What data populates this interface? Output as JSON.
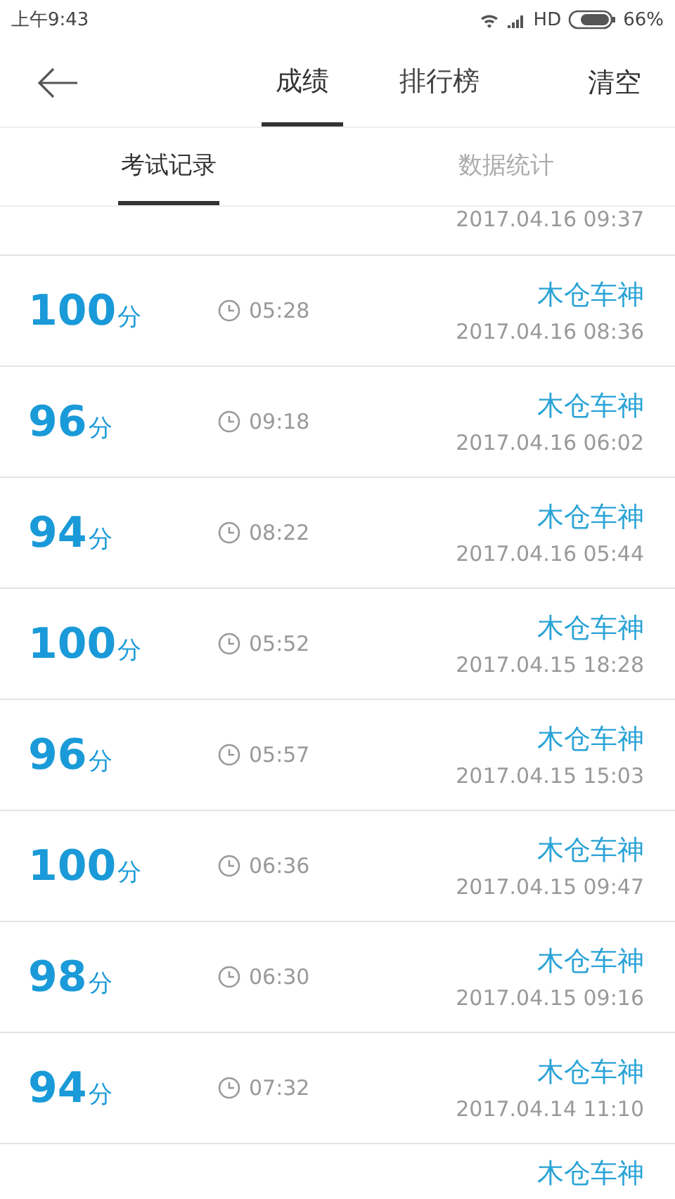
{
  "status_bar": {
    "time": "上午9:43",
    "network": "HD",
    "battery": "66%"
  },
  "header": {
    "tabs": [
      {
        "label": "成绩",
        "selected": true
      },
      {
        "label": "排行榜",
        "selected": false
      }
    ],
    "action": "清空"
  },
  "subtabs": [
    {
      "label": "考试记录",
      "selected": true
    },
    {
      "label": "数据统计",
      "selected": false
    }
  ],
  "records": [
    {
      "date": "2017.04.16  09:37"
    },
    {
      "score": "100",
      "unit": "分",
      "duration": "05:28",
      "name": "木仓车神",
      "date": "2017.04.16  08:36"
    },
    {
      "score": "96",
      "unit": "分",
      "duration": "09:18",
      "name": "木仓车神",
      "date": "2017.04.16  06:02"
    },
    {
      "score": "94",
      "unit": "分",
      "duration": "08:22",
      "name": "木仓车神",
      "date": "2017.04.16  05:44"
    },
    {
      "score": "100",
      "unit": "分",
      "duration": "05:52",
      "name": "木仓车神",
      "date": "2017.04.15  18:28"
    },
    {
      "score": "96",
      "unit": "分",
      "duration": "05:57",
      "name": "木仓车神",
      "date": "2017.04.15  15:03"
    },
    {
      "score": "100",
      "unit": "分",
      "duration": "06:36",
      "name": "木仓车神",
      "date": "2017.04.15  09:47"
    },
    {
      "score": "98",
      "unit": "分",
      "duration": "06:30",
      "name": "木仓车神",
      "date": "2017.04.15  09:16"
    },
    {
      "score": "94",
      "unit": "分",
      "duration": "07:32",
      "name": "木仓车神",
      "date": "2017.04.14  11:10"
    },
    {
      "name": "木仓车神"
    }
  ]
}
